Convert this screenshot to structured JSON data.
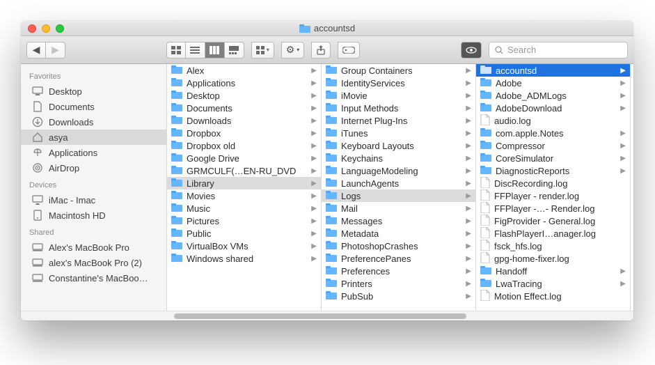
{
  "window": {
    "title": "accountsd"
  },
  "toolbar": {
    "search_placeholder": "Search"
  },
  "sidebar": {
    "sections": [
      {
        "title": "Favorites",
        "items": [
          {
            "icon": "desktop",
            "label": "Desktop"
          },
          {
            "icon": "documents",
            "label": "Documents"
          },
          {
            "icon": "downloads",
            "label": "Downloads"
          },
          {
            "icon": "home",
            "label": "asya",
            "selected": true
          },
          {
            "icon": "applications",
            "label": "Applications"
          },
          {
            "icon": "airdrop",
            "label": "AirDrop"
          }
        ]
      },
      {
        "title": "Devices",
        "items": [
          {
            "icon": "imac",
            "label": "iMac - Imac"
          },
          {
            "icon": "hdd",
            "label": "Macintosh HD"
          }
        ]
      },
      {
        "title": "Shared",
        "items": [
          {
            "icon": "net",
            "label": "Alex's MacBook Pro"
          },
          {
            "icon": "net",
            "label": "alex's MacBook Pro (2)"
          },
          {
            "icon": "net",
            "label": "Constantine's MacBoo…"
          }
        ]
      }
    ]
  },
  "columns": [
    {
      "scrollIndicator": false,
      "items": [
        {
          "type": "folder",
          "label": "Alex",
          "hasChildren": true
        },
        {
          "type": "folder",
          "label": "Applications",
          "hasChildren": true
        },
        {
          "type": "folder",
          "label": "Desktop",
          "hasChildren": true
        },
        {
          "type": "folder",
          "label": "Documents",
          "hasChildren": true
        },
        {
          "type": "folder",
          "label": "Downloads",
          "hasChildren": true
        },
        {
          "type": "folder",
          "label": "Dropbox",
          "hasChildren": true
        },
        {
          "type": "folder",
          "label": "Dropbox old",
          "hasChildren": true
        },
        {
          "type": "folder",
          "label": "Google Drive",
          "hasChildren": true
        },
        {
          "type": "folder",
          "label": "GRMCULF(…EN-RU_DVD",
          "hasChildren": true
        },
        {
          "type": "folder",
          "label": "Library",
          "hasChildren": true,
          "selection": "path"
        },
        {
          "type": "folder",
          "label": "Movies",
          "hasChildren": true
        },
        {
          "type": "folder",
          "label": "Music",
          "hasChildren": true
        },
        {
          "type": "folder",
          "label": "Pictures",
          "hasChildren": true
        },
        {
          "type": "folder",
          "label": "Public",
          "hasChildren": true
        },
        {
          "type": "folder",
          "label": "VirtualBox VMs",
          "hasChildren": true
        },
        {
          "type": "folder",
          "label": "Windows shared",
          "hasChildren": true
        }
      ]
    },
    {
      "scrollIndicator": true,
      "items": [
        {
          "type": "folder",
          "label": "Group Containers",
          "hasChildren": true
        },
        {
          "type": "folder",
          "label": "IdentityServices",
          "hasChildren": true
        },
        {
          "type": "folder",
          "label": "iMovie",
          "hasChildren": true
        },
        {
          "type": "folder",
          "label": "Input Methods",
          "hasChildren": true
        },
        {
          "type": "folder",
          "label": "Internet Plug-Ins",
          "hasChildren": true
        },
        {
          "type": "folder",
          "label": "iTunes",
          "hasChildren": true
        },
        {
          "type": "folder",
          "label": "Keyboard Layouts",
          "hasChildren": true
        },
        {
          "type": "folder",
          "label": "Keychains",
          "hasChildren": true
        },
        {
          "type": "folder",
          "label": "LanguageModeling",
          "hasChildren": true
        },
        {
          "type": "folder",
          "label": "LaunchAgents",
          "hasChildren": true
        },
        {
          "type": "folder",
          "label": "Logs",
          "hasChildren": true,
          "selection": "path"
        },
        {
          "type": "folder",
          "label": "Mail",
          "hasChildren": true
        },
        {
          "type": "folder",
          "label": "Messages",
          "hasChildren": true
        },
        {
          "type": "folder",
          "label": "Metadata",
          "hasChildren": true
        },
        {
          "type": "folder",
          "label": "PhotoshopCrashes",
          "hasChildren": true
        },
        {
          "type": "folder",
          "label": "PreferencePanes",
          "hasChildren": true
        },
        {
          "type": "folder",
          "label": "Preferences",
          "hasChildren": true
        },
        {
          "type": "folder",
          "label": "Printers",
          "hasChildren": true
        },
        {
          "type": "folder",
          "label": "PubSub",
          "hasChildren": true
        }
      ]
    },
    {
      "scrollIndicator": true,
      "items": [
        {
          "type": "folder",
          "label": "accountsd",
          "hasChildren": true,
          "selection": "active"
        },
        {
          "type": "folder",
          "label": "Adobe",
          "hasChildren": true
        },
        {
          "type": "folder",
          "label": "Adobe_ADMLogs",
          "hasChildren": true
        },
        {
          "type": "folder",
          "label": "AdobeDownload",
          "hasChildren": true
        },
        {
          "type": "file",
          "label": "audio.log"
        },
        {
          "type": "folder",
          "label": "com.apple.Notes",
          "hasChildren": true
        },
        {
          "type": "folder",
          "label": "Compressor",
          "hasChildren": true
        },
        {
          "type": "folder",
          "label": "CoreSimulator",
          "hasChildren": true
        },
        {
          "type": "folder",
          "label": "DiagnosticReports",
          "hasChildren": true
        },
        {
          "type": "file",
          "label": "DiscRecording.log"
        },
        {
          "type": "file",
          "label": "FFPlayer - render.log"
        },
        {
          "type": "file",
          "label": "FFPlayer -…- Render.log"
        },
        {
          "type": "file",
          "label": "FigProvider - General.log"
        },
        {
          "type": "file",
          "label": "FlashPlayerI…anager.log"
        },
        {
          "type": "file",
          "label": "fsck_hfs.log"
        },
        {
          "type": "file",
          "label": "gpg-home-fixer.log"
        },
        {
          "type": "folder",
          "label": "Handoff",
          "hasChildren": true
        },
        {
          "type": "folder",
          "label": "LwaTracing",
          "hasChildren": true
        },
        {
          "type": "file",
          "label": "Motion Effect.log"
        }
      ]
    }
  ]
}
